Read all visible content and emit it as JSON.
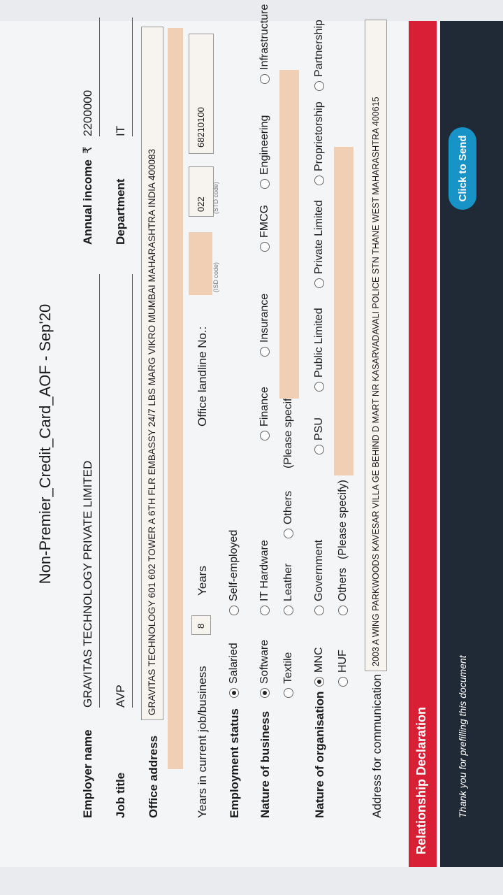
{
  "document": {
    "title": "Non-Premier_Credit_Card_AOF - Sep'20"
  },
  "employer": {
    "label": "Employer name",
    "value": "GRAVITAS TECHNOLOGY PRIVATE LIMITED",
    "annual_income_label": "Annual income",
    "currency": "₹",
    "annual_income_value": "2200000"
  },
  "job": {
    "label": "Job title",
    "value": "AVP",
    "department_label": "Department",
    "department_value": "IT"
  },
  "office": {
    "label": "Office address",
    "value": "GRAVITAS TECHNOLOGY 601 602 TOWER A 6TH FLR EMBASSY 24/7 LBS MARG VIKRO MUMBAI MAHARASHTRA INDIA 400083"
  },
  "years": {
    "label": "Years in current job/business",
    "value": "8",
    "unit": "Years",
    "landline_label": "Office landline No.:",
    "isd_hint": "(ISD code)",
    "std_value": "022",
    "std_hint": "(STD code)",
    "number": "68210100"
  },
  "employment": {
    "label": "Employment status",
    "options": [
      "Salaried",
      "Self-employed"
    ]
  },
  "business": {
    "label": "Nature of business",
    "row1": [
      "Software",
      "IT Hardware",
      "Finance",
      "Insurance",
      "FMCG",
      "Engineering",
      "Infrastructure"
    ],
    "row2": [
      "Textile",
      "Leather",
      "Others"
    ],
    "specify": "(Please specify)"
  },
  "organisation": {
    "label": "Nature of organisation",
    "row1": [
      "MNC",
      "Government",
      "PSU",
      "Public Limited",
      "Private Limited",
      "Proprietorship",
      "Partnership"
    ],
    "row2": [
      "HUF",
      "Others"
    ],
    "specify": "(Please specify)"
  },
  "communication": {
    "label": "Address for communication",
    "value": "2003 A WING PARKWOODS KAVESAR VILLA GE BEHIND D MART NR KASARVADAVALI POLICE STN THANE WEST MAHARASHTRA 400615"
  },
  "relationship": {
    "label": "Relationship Declaration"
  },
  "footer": {
    "thanks": "Thank you for prefilling this document",
    "send": "Click to Send"
  },
  "colors": {
    "accent_red": "#d81f35",
    "footer_bg": "#1f2a36",
    "send_blue": "#1793c7",
    "field_peach": "#f1cfb4"
  }
}
